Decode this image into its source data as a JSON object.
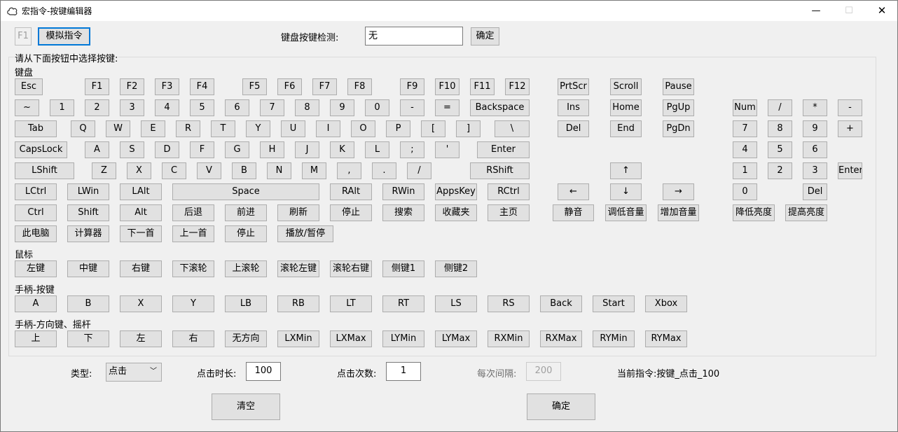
{
  "window": {
    "title": "宏指令-按键编辑器",
    "controls": {
      "minimize": "—",
      "maximize": "☐",
      "close": "✕"
    }
  },
  "top": {
    "f1_label": "F1",
    "simulate_label": "模拟指令",
    "detect_label": "键盘按键检测:",
    "detect_value": "无",
    "confirm_label": "确定"
  },
  "group_title": "请从下面按钮中选择按键:",
  "sections": {
    "keyboard": "键盘",
    "mouse": "鼠标",
    "gamepad_buttons": "手柄-按键",
    "gamepad_dir": "手柄-方向键、摇杆"
  },
  "keys": {
    "esc": "Esc",
    "f1": "F1",
    "f2": "F2",
    "f3": "F3",
    "f4": "F4",
    "f5": "F5",
    "f6": "F6",
    "f7": "F7",
    "f8": "F8",
    "f9": "F9",
    "f10": "F10",
    "f11": "F11",
    "f12": "F12",
    "prtscr": "PrtScr",
    "scroll": "Scroll",
    "pause": "Pause",
    "tilde": "~",
    "k1": "1",
    "k2": "2",
    "k3": "3",
    "k4": "4",
    "k5": "5",
    "k6": "6",
    "k7": "7",
    "k8": "8",
    "k9": "9",
    "k0": "0",
    "minus": "-",
    "equal": "=",
    "backspace": "Backspace",
    "ins": "Ins",
    "home": "Home",
    "pgup": "PgUp",
    "num": "Num",
    "np_div": "/",
    "np_mul": "*",
    "np_sub": "-",
    "tab": "Tab",
    "q": "Q",
    "w": "W",
    "e": "E",
    "r": "R",
    "t": "T",
    "y": "Y",
    "u": "U",
    "i": "I",
    "o": "O",
    "p": "P",
    "lbr": "[",
    "rbr": "]",
    "bslash": "\\",
    "del": "Del",
    "end": "End",
    "pgdn": "PgDn",
    "np7": "7",
    "np8": "8",
    "np9": "9",
    "np_add": "+",
    "caps": "CapsLock",
    "a": "A",
    "s": "S",
    "d": "D",
    "f": "F",
    "g": "G",
    "h": "H",
    "j": "J",
    "k": "K",
    "l": "L",
    "semi": ";",
    "quote": "'",
    "enter": "Enter",
    "np4": "4",
    "np5": "5",
    "np6": "6",
    "lshift": "LShift",
    "z": "Z",
    "x": "X",
    "c": "C",
    "v": "V",
    "b": "B",
    "n": "N",
    "m": "M",
    "comma": ",",
    "period": ".",
    "slash": "/",
    "rshift": "RShift",
    "up": "↑",
    "np1": "1",
    "np2": "2",
    "np3": "3",
    "np_enter": "Enter",
    "lctrl": "LCtrl",
    "lwin": "LWin",
    "lalt": "LAlt",
    "space": "Space",
    "ralt": "RAlt",
    "rwin": "RWin",
    "apps": "AppsKey",
    "rctrl": "RCtrl",
    "left": "←",
    "down": "↓",
    "right": "→",
    "np0": "0",
    "np_del": "Del",
    "ctrl": "Ctrl",
    "shift": "Shift",
    "alt": "Alt",
    "back": "后退",
    "forward": "前进",
    "refresh": "刷新",
    "stop": "停止",
    "search": "搜索",
    "favorites": "收藏夹",
    "homepage": "主页",
    "mute": "静音",
    "vol_down": "调低音量",
    "vol_up": "增加音量",
    "bright_down": "降低亮度",
    "bright_up": "提高亮度",
    "mypc": "此电脑",
    "calc": "计算器",
    "next": "下一首",
    "prev": "上一首",
    "media_stop": "停止",
    "play_pause": "播放/暂停"
  },
  "mouse": {
    "left": "左键",
    "middle": "中键",
    "right": "右键",
    "wheel_down": "下滚轮",
    "wheel_up": "上滚轮",
    "wheel_left": "滚轮左键",
    "wheel_right": "滚轮右键",
    "side1": "侧键1",
    "side2": "侧键2"
  },
  "gamepad": {
    "a": "A",
    "b": "B",
    "x": "X",
    "y": "Y",
    "lb": "LB",
    "rb": "RB",
    "lt": "LT",
    "rt": "RT",
    "ls": "LS",
    "rs": "RS",
    "back": "Back",
    "start": "Start",
    "xbox": "Xbox"
  },
  "gamepad_dir": {
    "up": "上",
    "down": "下",
    "left": "左",
    "right": "右",
    "none": "无方向",
    "lxmin": "LXMin",
    "lxmax": "LXMax",
    "lymin": "LYMin",
    "lymax": "LYMax",
    "rxmin": "RXMin",
    "rxmax": "RXMax",
    "rymin": "RYMin",
    "rymax": "RYMax"
  },
  "bottom": {
    "type_label": "类型:",
    "type_value": "点击",
    "duration_label": "点击时长:",
    "duration_value": "100",
    "count_label": "点击次数:",
    "count_value": "1",
    "interval_label": "每次间隔:",
    "interval_value": "200",
    "current_label": "当前指令:按键_点击_100",
    "clear_label": "清空",
    "ok_label": "确定"
  }
}
